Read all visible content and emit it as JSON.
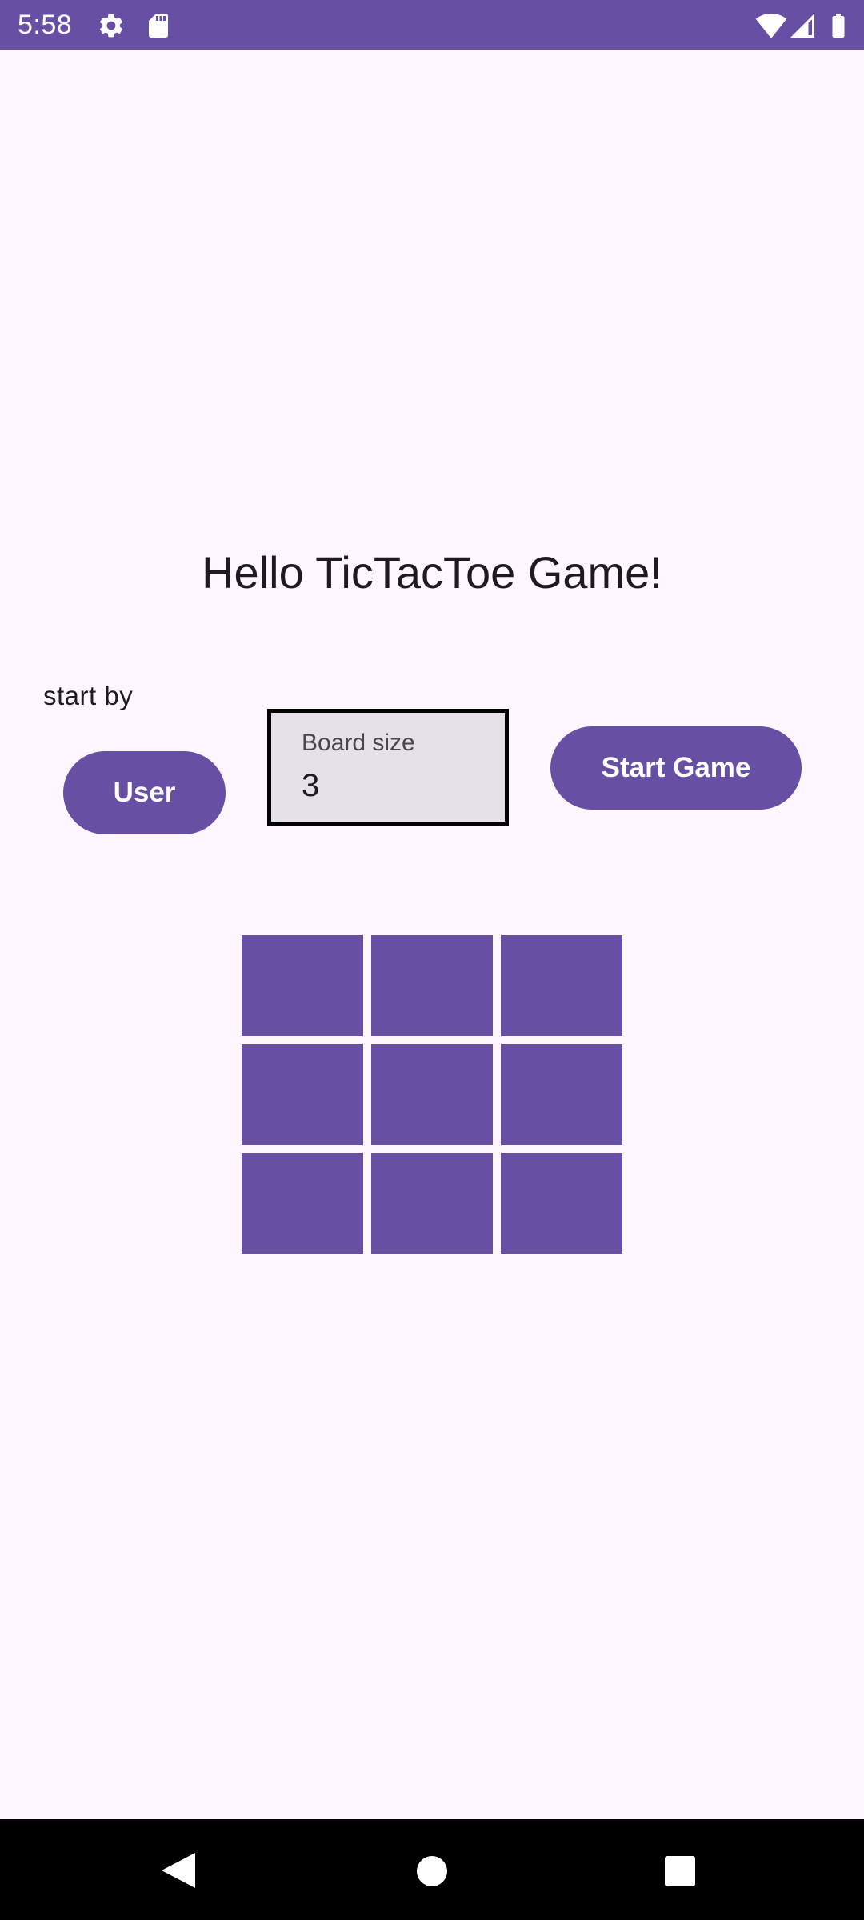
{
  "status_bar": {
    "time": "5:58",
    "icons": [
      "settings-icon",
      "sd-card-icon",
      "wifi-icon",
      "signal-icon",
      "battery-icon"
    ],
    "background": "#6750A4"
  },
  "main": {
    "title": "Hello TicTacToe Game!",
    "start_by_label": "start by",
    "user_button_label": "User",
    "board_size": {
      "label": "Board size",
      "value": "3"
    },
    "start_game_button_label": "Start Game",
    "grid": {
      "rows": 3,
      "cols": 3,
      "cells": [
        "",
        "",
        "",
        "",
        "",
        "",
        "",
        "",
        ""
      ]
    }
  },
  "nav_bar": {
    "icons": [
      "back-icon",
      "home-icon",
      "recents-icon"
    ]
  },
  "colors": {
    "accent": "#6750A4",
    "background": "#FEF7FF",
    "field_background": "#E6E0E9",
    "text": "#1D1B20"
  }
}
